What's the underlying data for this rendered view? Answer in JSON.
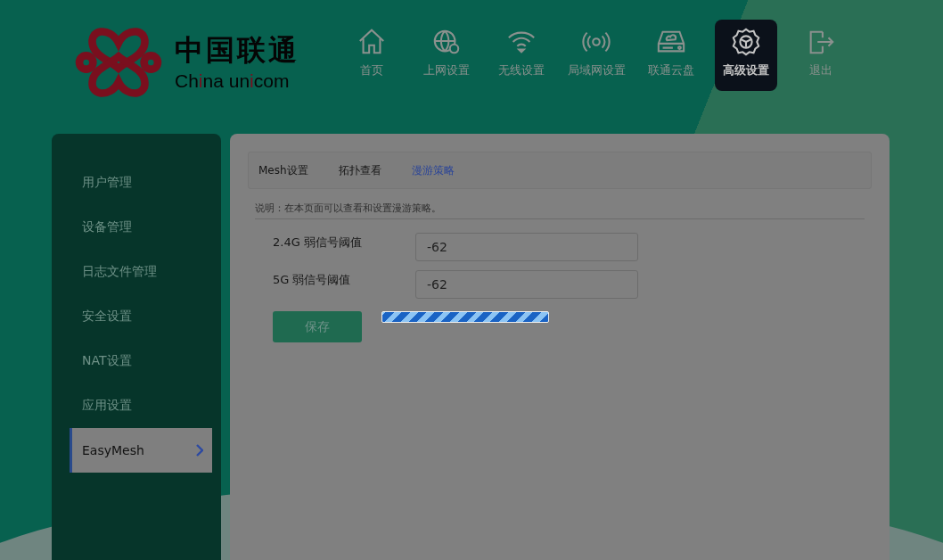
{
  "logo": {
    "name_cn": "中国联通",
    "name_en_parts": [
      "Ch",
      "i",
      "na un",
      "i",
      "com"
    ]
  },
  "nav": [
    {
      "label": "首页",
      "selected": false
    },
    {
      "label": "上网设置",
      "selected": false
    },
    {
      "label": "无线设置",
      "selected": false
    },
    {
      "label": "局域网设置",
      "selected": false
    },
    {
      "label": "联通云盘",
      "selected": false
    },
    {
      "label": "高级设置",
      "selected": true
    },
    {
      "label": "退出",
      "selected": false
    }
  ],
  "sidebar": {
    "items": [
      {
        "label": "用户管理",
        "selected": false
      },
      {
        "label": "设备管理",
        "selected": false
      },
      {
        "label": "日志文件管理",
        "selected": false
      },
      {
        "label": "安全设置",
        "selected": false
      },
      {
        "label": "NAT设置",
        "selected": false
      },
      {
        "label": "应用设置",
        "selected": false
      },
      {
        "label": "EasyMesh",
        "selected": true
      }
    ]
  },
  "tabs": [
    {
      "label": "Mesh设置",
      "selected": false
    },
    {
      "label": "拓扑查看",
      "selected": false
    },
    {
      "label": "漫游策略",
      "selected": true
    }
  ],
  "description": "说明：在本页面可以查看和设置漫游策略。",
  "fields": [
    {
      "label": "2.4G 弱信号阈值",
      "value": "-62"
    },
    {
      "label": "5G 弱信号阈值",
      "value": "-62"
    }
  ],
  "save_button": "保存"
}
